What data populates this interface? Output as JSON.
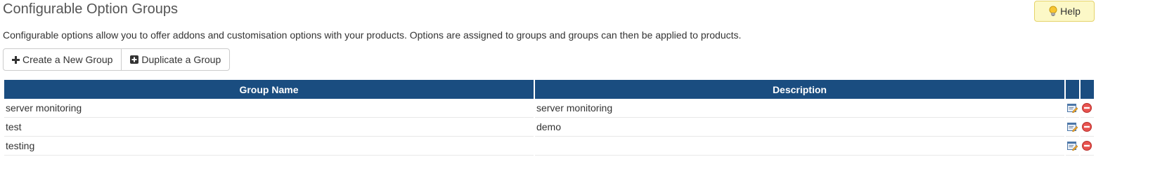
{
  "header": {
    "title": "Configurable Option Groups",
    "help_label": "Help"
  },
  "intro_text": "Configurable options allow you to offer addons and customisation options with your products. Options are assigned to groups and groups can then be applied to products.",
  "toolbar": {
    "create_label": "Create a New Group",
    "duplicate_label": "Duplicate a Group"
  },
  "table": {
    "columns": [
      "Group Name",
      "Description",
      "",
      ""
    ],
    "rows": [
      {
        "name": "server monitoring",
        "description": "server monitoring"
      },
      {
        "name": "test",
        "description": "demo"
      },
      {
        "name": "testing",
        "description": ""
      }
    ]
  },
  "icons": {
    "help": "lightbulb-icon",
    "create": "plus-icon",
    "duplicate": "plus-square-icon",
    "edit": "edit-icon",
    "delete": "delete-icon"
  },
  "colors": {
    "table_header_bg": "#1a4d80",
    "help_bg": "#fcf8c7",
    "delete_red": "#d9534f"
  }
}
